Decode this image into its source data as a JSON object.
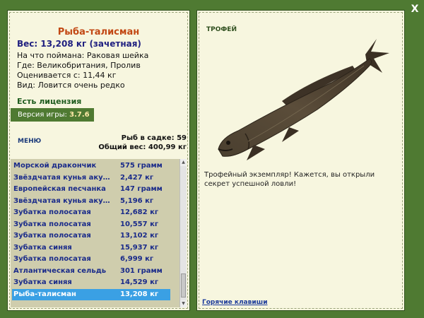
{
  "window": {
    "close_label": "X"
  },
  "fish": {
    "title": "Рыба-талисман",
    "weight": "Вес: 13,208 кг (зачетная)",
    "bait": "На что поймана: Раковая шейка",
    "place": "Где: Великобритания, Пролив",
    "value": "Оценивается с: 11,44 кг",
    "kind": "Вид: Ловится очень редко"
  },
  "license": "Есть лицензия",
  "version": {
    "label": "Версия игры: ",
    "number": "3.7.6"
  },
  "menu_label": "МЕНЮ",
  "stats": {
    "count": "Рыб в садке: 59",
    "total": "Общий вес: 400,99 кг"
  },
  "catch_list": [
    {
      "name": "Морской дракончик",
      "weight": "575 грамм"
    },
    {
      "name": "Звёздчатая кунья аку...",
      "weight": "2,427 кг"
    },
    {
      "name": "Европейская песчанка",
      "weight": "147 грамм"
    },
    {
      "name": "Звёздчатая кунья аку...",
      "weight": "5,196 кг"
    },
    {
      "name": "Зубатка полосатая",
      "weight": "12,682 кг"
    },
    {
      "name": "Зубатка полосатая",
      "weight": "10,557 кг"
    },
    {
      "name": "Зубатка полосатая",
      "weight": "13,102 кг"
    },
    {
      "name": "Зубатка синяя",
      "weight": "15,937 кг"
    },
    {
      "name": "Зубатка полосатая",
      "weight": "6,999 кг"
    },
    {
      "name": "Атлантическая сельдь",
      "weight": "301 грамм"
    },
    {
      "name": "Зубатка синяя",
      "weight": "14,529 кг"
    },
    {
      "name": "Рыба-талисман",
      "weight": "13,208 кг",
      "selected": true
    }
  ],
  "trophy": {
    "label": "ТРОФЕЙ",
    "text": "Трофейный экземпляр! Кажется, вы открыли секрет успешной ловли!"
  },
  "hotkeys_label": "Горячие клавиши",
  "colors": {
    "frame": "#4f7a32",
    "panel": "#f7f6df",
    "selected": "#3aa0e4",
    "title": "#c24814",
    "list_text": "#1a2b8a"
  },
  "icons": {
    "close": "close-icon",
    "scroll_up": "arrow-up-icon",
    "scroll_down": "arrow-down-icon"
  }
}
